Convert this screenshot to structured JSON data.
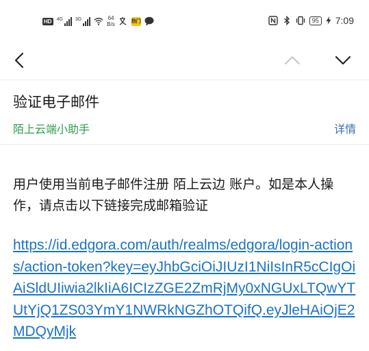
{
  "status_bar": {
    "hd": "HD",
    "net1_label": "4G",
    "net2_label": "3G",
    "speed_value": "64",
    "speed_unit": "B/s",
    "badge": "热门",
    "battery": "95",
    "time": "7:09",
    "icons": [
      "signal-icon",
      "wifi-icon",
      "translate-icon",
      "chat-bubble-icon",
      "nfc-icon",
      "bluetooth-icon",
      "vibrate-icon",
      "charging-icon"
    ]
  },
  "nav": {
    "icons": [
      "back-arrow-icon",
      "previous-email-icon",
      "next-email-icon"
    ]
  },
  "email": {
    "subject": "验证电子邮件",
    "sender": "陌上云端小助手",
    "details_label": "详情",
    "body_text": "用户使用当前电子邮件注册 陌上云边 账户。如是本人操作，请点击以下链接完成邮箱验证",
    "link": "https://id.edgora.com/auth/realms/edgora/login-actions/action-token?key=eyJhbGciOiJIUzI1NiIsInR5cCIgOiAiSldUIiwia2lkIiA6ICIzZGE2ZmRjMy0xNGUxLTQwYTUtYjQ1ZS03YmY1NWRkNGZhOTQifQ.eyJleHAiOjE2MDQyMjk"
  },
  "colors": {
    "sender_green": "#2e9e4c",
    "details_blue": "#3a6fb0",
    "link_blue": "#1a73c8"
  }
}
